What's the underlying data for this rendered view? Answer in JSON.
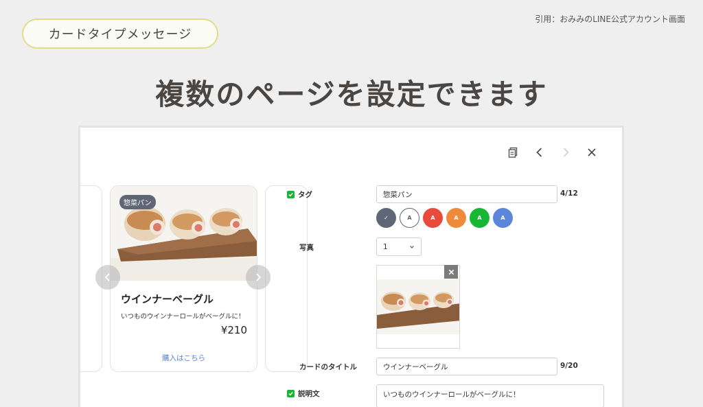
{
  "header": {
    "pill_label": "カードタイプメッセージ",
    "citation": "引用：おみみのLINE公式アカウント画面",
    "headline": "複数のページを設定できます"
  },
  "toolbar": {
    "icons": [
      "copy-icon",
      "chevron-left-icon",
      "chevron-right-icon",
      "close-icon"
    ]
  },
  "card": {
    "tag": "惣菜パン",
    "title": "ウインナーベーグル",
    "description": "いつものウインナーロールがベーグルに！",
    "price": "¥210",
    "link_label": "購入はこちら"
  },
  "form": {
    "tag_label": "タグ",
    "tag_value": "惣菜パン",
    "tag_count": "4/12",
    "color_swatches": [
      {
        "color": "#5f6675",
        "selected": true,
        "letter": "✓"
      },
      {
        "color": "#ffffff",
        "selected": false,
        "letter": "A"
      },
      {
        "color": "#e84a3c",
        "selected": false,
        "letter": "A"
      },
      {
        "color": "#ee8a3a",
        "selected": false,
        "letter": "A"
      },
      {
        "color": "#17b634",
        "selected": false,
        "letter": "A"
      },
      {
        "color": "#5b86da",
        "selected": false,
        "letter": "A"
      }
    ],
    "photo_label": "写真",
    "photo_count_value": "1",
    "title_label": "カードのタイトル",
    "title_value": "ウインナーベーグル",
    "title_count": "9/20",
    "desc_label": "説明文",
    "desc_value": "いつものウインナーロールがベーグルに！"
  },
  "colors": {
    "accent_green": "#1fb134",
    "link_blue": "#5a84d6",
    "tag_badge": "#5f6675",
    "pill_border": "#e2dc8a"
  }
}
